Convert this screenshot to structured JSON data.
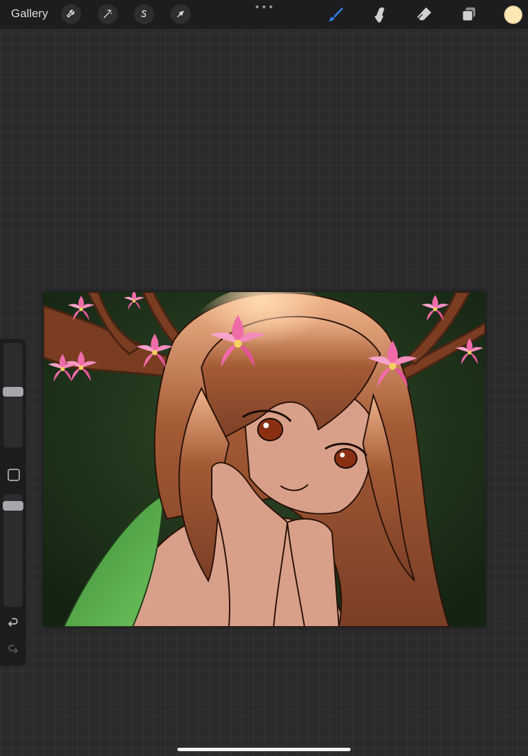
{
  "app": {
    "gallery_label": "Gallery",
    "left_tools": [
      {
        "name": "actions",
        "icon": "wrench-icon"
      },
      {
        "name": "adjustments",
        "icon": "magic-wand-icon"
      },
      {
        "name": "selection",
        "icon": "selection-s-icon"
      },
      {
        "name": "transform",
        "icon": "arrow-cursor-icon"
      }
    ],
    "right_tools": [
      {
        "name": "brush",
        "icon": "brush-icon",
        "active": true
      },
      {
        "name": "smudge",
        "icon": "smudge-finger-icon",
        "active": false
      },
      {
        "name": "eraser",
        "icon": "eraser-icon",
        "active": false
      },
      {
        "name": "layers",
        "icon": "layers-icon",
        "active": false
      }
    ],
    "current_color": "#ffe7b4",
    "accent_color": "#2f7de1"
  },
  "sidebar": {
    "brush_size_level": 0.55,
    "opacity_level": 0.9,
    "modify_icon": "square-outline-icon",
    "undo_icon": "undo-arrow-icon",
    "redo_icon": "redo-arrow-icon"
  },
  "canvas": {
    "background_color": "#223a1f",
    "hair_color": "#8a4a2e",
    "skin_color": "#d9a089",
    "flower_color": "#f06ca8",
    "antler_color": "#6b3520"
  }
}
